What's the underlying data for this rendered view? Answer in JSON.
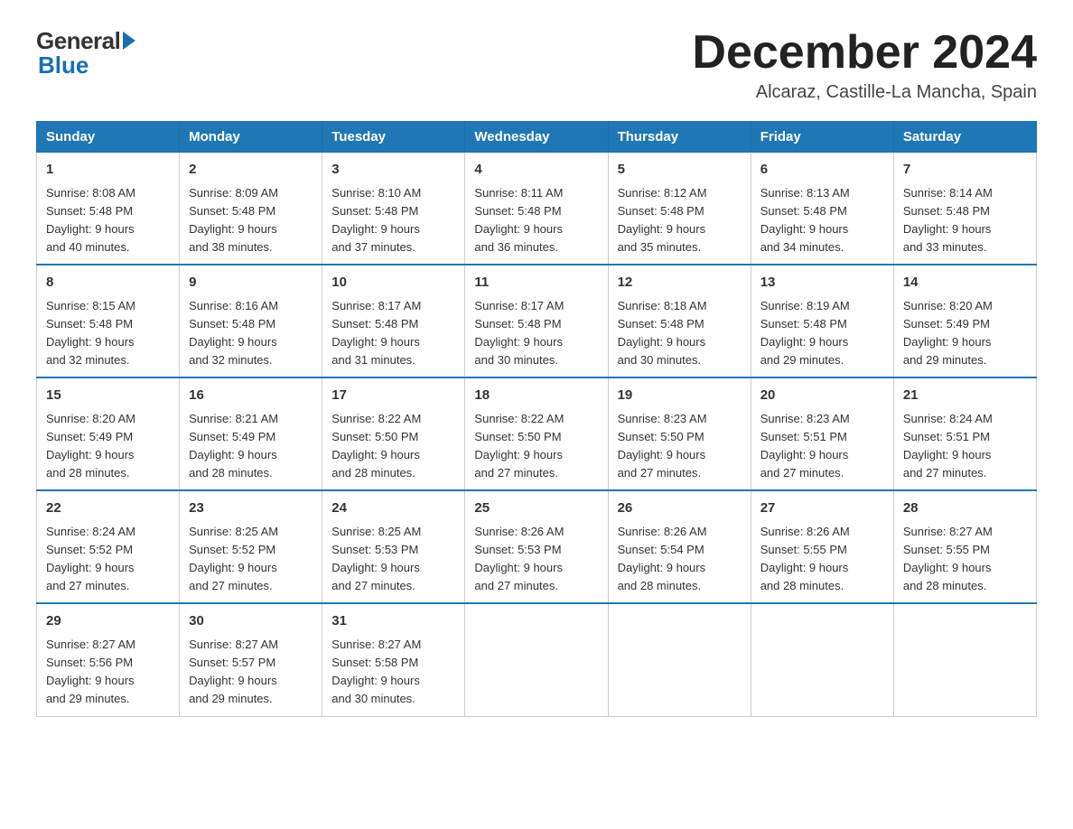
{
  "logo": {
    "general": "General",
    "blue": "Blue"
  },
  "title": "December 2024",
  "location": "Alcaraz, Castille-La Mancha, Spain",
  "headers": [
    "Sunday",
    "Monday",
    "Tuesday",
    "Wednesday",
    "Thursday",
    "Friday",
    "Saturday"
  ],
  "weeks": [
    [
      {
        "day": "1",
        "info": "Sunrise: 8:08 AM\nSunset: 5:48 PM\nDaylight: 9 hours\nand 40 minutes."
      },
      {
        "day": "2",
        "info": "Sunrise: 8:09 AM\nSunset: 5:48 PM\nDaylight: 9 hours\nand 38 minutes."
      },
      {
        "day": "3",
        "info": "Sunrise: 8:10 AM\nSunset: 5:48 PM\nDaylight: 9 hours\nand 37 minutes."
      },
      {
        "day": "4",
        "info": "Sunrise: 8:11 AM\nSunset: 5:48 PM\nDaylight: 9 hours\nand 36 minutes."
      },
      {
        "day": "5",
        "info": "Sunrise: 8:12 AM\nSunset: 5:48 PM\nDaylight: 9 hours\nand 35 minutes."
      },
      {
        "day": "6",
        "info": "Sunrise: 8:13 AM\nSunset: 5:48 PM\nDaylight: 9 hours\nand 34 minutes."
      },
      {
        "day": "7",
        "info": "Sunrise: 8:14 AM\nSunset: 5:48 PM\nDaylight: 9 hours\nand 33 minutes."
      }
    ],
    [
      {
        "day": "8",
        "info": "Sunrise: 8:15 AM\nSunset: 5:48 PM\nDaylight: 9 hours\nand 32 minutes."
      },
      {
        "day": "9",
        "info": "Sunrise: 8:16 AM\nSunset: 5:48 PM\nDaylight: 9 hours\nand 32 minutes."
      },
      {
        "day": "10",
        "info": "Sunrise: 8:17 AM\nSunset: 5:48 PM\nDaylight: 9 hours\nand 31 minutes."
      },
      {
        "day": "11",
        "info": "Sunrise: 8:17 AM\nSunset: 5:48 PM\nDaylight: 9 hours\nand 30 minutes."
      },
      {
        "day": "12",
        "info": "Sunrise: 8:18 AM\nSunset: 5:48 PM\nDaylight: 9 hours\nand 30 minutes."
      },
      {
        "day": "13",
        "info": "Sunrise: 8:19 AM\nSunset: 5:48 PM\nDaylight: 9 hours\nand 29 minutes."
      },
      {
        "day": "14",
        "info": "Sunrise: 8:20 AM\nSunset: 5:49 PM\nDaylight: 9 hours\nand 29 minutes."
      }
    ],
    [
      {
        "day": "15",
        "info": "Sunrise: 8:20 AM\nSunset: 5:49 PM\nDaylight: 9 hours\nand 28 minutes."
      },
      {
        "day": "16",
        "info": "Sunrise: 8:21 AM\nSunset: 5:49 PM\nDaylight: 9 hours\nand 28 minutes."
      },
      {
        "day": "17",
        "info": "Sunrise: 8:22 AM\nSunset: 5:50 PM\nDaylight: 9 hours\nand 28 minutes."
      },
      {
        "day": "18",
        "info": "Sunrise: 8:22 AM\nSunset: 5:50 PM\nDaylight: 9 hours\nand 27 minutes."
      },
      {
        "day": "19",
        "info": "Sunrise: 8:23 AM\nSunset: 5:50 PM\nDaylight: 9 hours\nand 27 minutes."
      },
      {
        "day": "20",
        "info": "Sunrise: 8:23 AM\nSunset: 5:51 PM\nDaylight: 9 hours\nand 27 minutes."
      },
      {
        "day": "21",
        "info": "Sunrise: 8:24 AM\nSunset: 5:51 PM\nDaylight: 9 hours\nand 27 minutes."
      }
    ],
    [
      {
        "day": "22",
        "info": "Sunrise: 8:24 AM\nSunset: 5:52 PM\nDaylight: 9 hours\nand 27 minutes."
      },
      {
        "day": "23",
        "info": "Sunrise: 8:25 AM\nSunset: 5:52 PM\nDaylight: 9 hours\nand 27 minutes."
      },
      {
        "day": "24",
        "info": "Sunrise: 8:25 AM\nSunset: 5:53 PM\nDaylight: 9 hours\nand 27 minutes."
      },
      {
        "day": "25",
        "info": "Sunrise: 8:26 AM\nSunset: 5:53 PM\nDaylight: 9 hours\nand 27 minutes."
      },
      {
        "day": "26",
        "info": "Sunrise: 8:26 AM\nSunset: 5:54 PM\nDaylight: 9 hours\nand 28 minutes."
      },
      {
        "day": "27",
        "info": "Sunrise: 8:26 AM\nSunset: 5:55 PM\nDaylight: 9 hours\nand 28 minutes."
      },
      {
        "day": "28",
        "info": "Sunrise: 8:27 AM\nSunset: 5:55 PM\nDaylight: 9 hours\nand 28 minutes."
      }
    ],
    [
      {
        "day": "29",
        "info": "Sunrise: 8:27 AM\nSunset: 5:56 PM\nDaylight: 9 hours\nand 29 minutes."
      },
      {
        "day": "30",
        "info": "Sunrise: 8:27 AM\nSunset: 5:57 PM\nDaylight: 9 hours\nand 29 minutes."
      },
      {
        "day": "31",
        "info": "Sunrise: 8:27 AM\nSunset: 5:58 PM\nDaylight: 9 hours\nand 30 minutes."
      },
      {
        "day": "",
        "info": ""
      },
      {
        "day": "",
        "info": ""
      },
      {
        "day": "",
        "info": ""
      },
      {
        "day": "",
        "info": ""
      }
    ]
  ]
}
